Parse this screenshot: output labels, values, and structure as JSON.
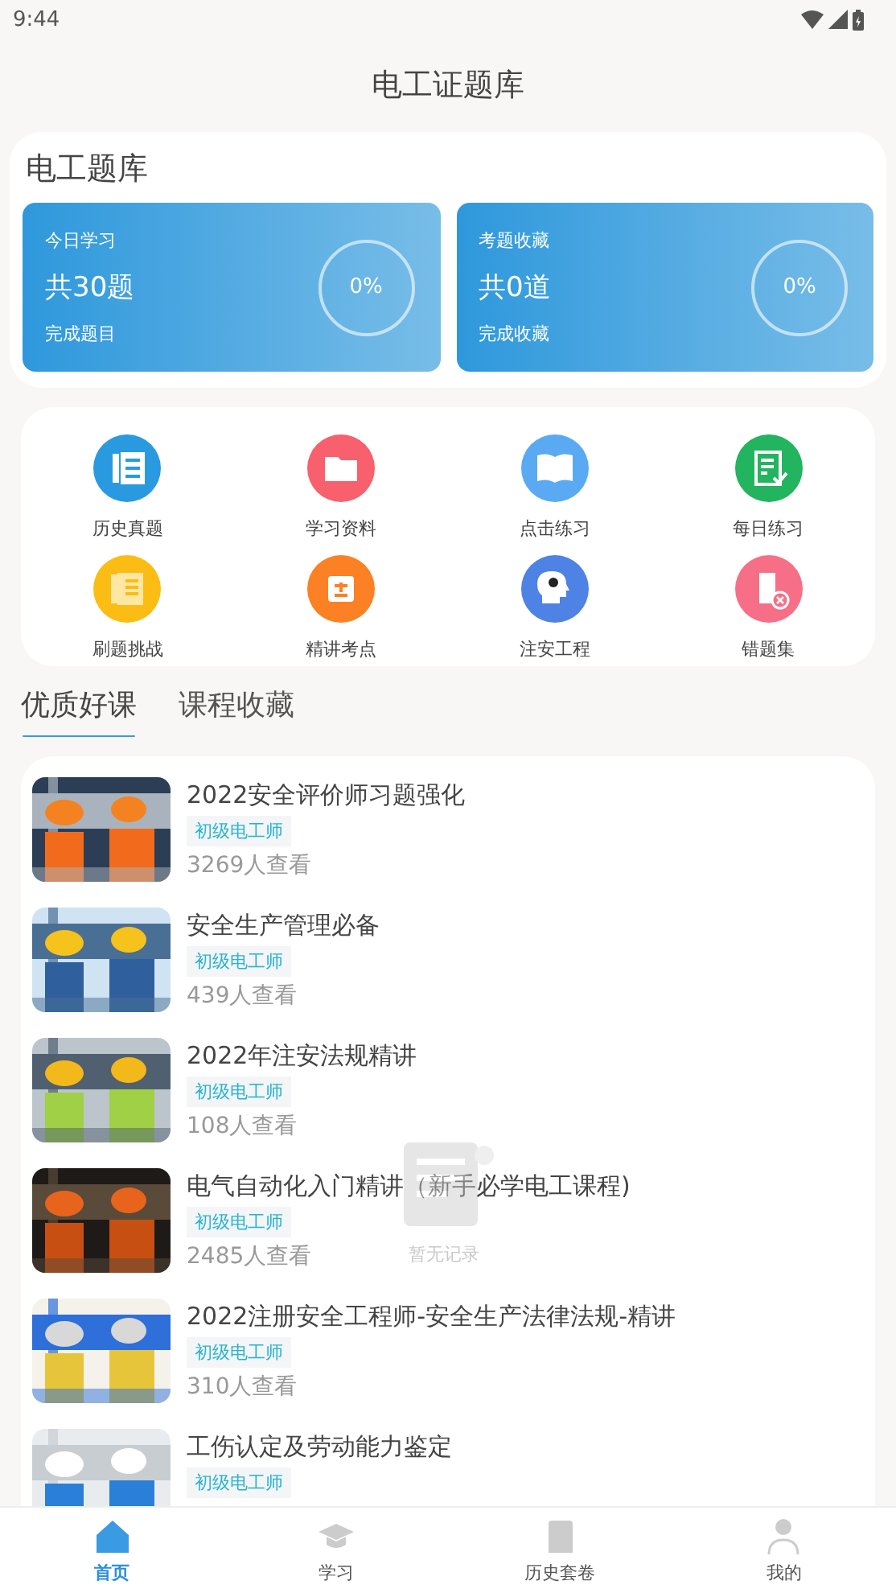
{
  "status_bar": {
    "time": "9:44"
  },
  "header": {
    "title": "电工证题库"
  },
  "bank": {
    "title": "电工题库",
    "cards": [
      {
        "label": "今日学习",
        "count": "共30题",
        "percent": "0%",
        "caption": "完成题目"
      },
      {
        "label": "考题收藏",
        "count": "共0道",
        "percent": "0%",
        "caption": "完成收藏"
      }
    ]
  },
  "features": [
    {
      "label": "历史真题"
    },
    {
      "label": "学习资料"
    },
    {
      "label": "点击练习"
    },
    {
      "label": "每日练习"
    },
    {
      "label": "刷题挑战"
    },
    {
      "label": "精讲考点"
    },
    {
      "label": "注安工程"
    },
    {
      "label": "错题集"
    }
  ],
  "course_tabs": [
    {
      "label": "优质好课",
      "selected": true
    },
    {
      "label": "课程收藏",
      "selected": false
    }
  ],
  "courses": [
    {
      "title": "2022安全评价师习题强化",
      "tag": "初级电工师",
      "views": "3269人查看"
    },
    {
      "title": "安全生产管理必备",
      "tag": "初级电工师",
      "views": "439人查看"
    },
    {
      "title": "2022年注安法规精讲",
      "tag": "初级电工师",
      "views": "108人查看"
    },
    {
      "title": "电气自动化入门精讲（新手必学电工课程)",
      "tag": "初级电工师",
      "views": "2485人查看"
    },
    {
      "title": "2022注册安全工程师-安全生产法律法规-精讲",
      "tag": "初级电工师",
      "views": "310人查看"
    },
    {
      "title": "工伤认定及劳动能力鉴定",
      "tag": "初级电工师"
    }
  ],
  "empty_state": {
    "text": "暂无记录"
  },
  "bottom_nav": [
    {
      "label": "首页",
      "selected": true
    },
    {
      "label": "学习",
      "selected": false
    },
    {
      "label": "历史套卷",
      "selected": false
    },
    {
      "label": "我的",
      "selected": false
    }
  ]
}
